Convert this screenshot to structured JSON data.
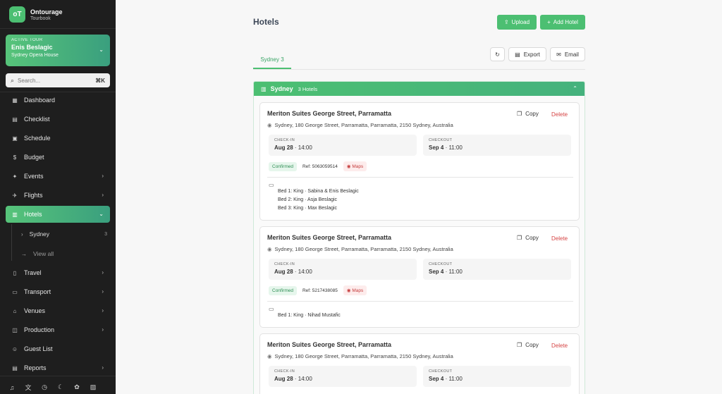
{
  "brand": {
    "logo": "oT",
    "name": "Ontourage",
    "sub": "Tourbook"
  },
  "tour": {
    "label": "ACTIVE TOUR",
    "name": "Enis Beslagic",
    "venue": "Sydney Opera House"
  },
  "search": {
    "placeholder": "Search...",
    "shortcut": "⌘K"
  },
  "nav": [
    {
      "label": "Dashboard"
    },
    {
      "label": "Checklist"
    },
    {
      "label": "Schedule"
    },
    {
      "label": "Budget"
    },
    {
      "label": "Events"
    },
    {
      "label": "Flights"
    },
    {
      "label": "Hotels"
    },
    {
      "label": "Travel"
    },
    {
      "label": "Transport"
    },
    {
      "label": "Venues"
    },
    {
      "label": "Production"
    },
    {
      "label": "Guest List"
    },
    {
      "label": "Reports"
    }
  ],
  "hotels_sub": [
    {
      "label": "Sydney",
      "count": "3"
    },
    {
      "label": "View all"
    }
  ],
  "page": {
    "title": "Hotels",
    "upload": "Upload",
    "add_hotel": "Add Hotel",
    "tab": "Sydney 3",
    "export": "Export",
    "email": "Email"
  },
  "group": {
    "name": "Sydney",
    "count": "3 Hotels"
  },
  "cards": [
    {
      "name": "Meriton Suites George Street, Parramatta",
      "address": "Sydney, 180 George Street, Parramatta, Parramatta, 2150 Sydney, Australia",
      "copy": "Copy",
      "delete": "Delete",
      "checkin_label": "CHECK-IN",
      "checkin_date": "Aug 28",
      "checkin_time": " · 14:00",
      "checkout_label": "CHECKOUT",
      "checkout_date": "Sep 4",
      "checkout_time": " · 11:00",
      "status": "Confirmed",
      "ref": "Ref: 5063059514",
      "maps": "Maps",
      "beds": [
        "Bed 1: King · Sabina & Enis Beslagic",
        "Bed 2: King · Asja Beslagic",
        "Bed 3: King · Max Beslagic"
      ]
    },
    {
      "name": "Meriton Suites George Street, Parramatta",
      "address": "Sydney, 180 George Street, Parramatta, Parramatta, 2150 Sydney, Australia",
      "copy": "Copy",
      "delete": "Delete",
      "checkin_label": "CHECK-IN",
      "checkin_date": "Aug 28",
      "checkin_time": " · 14:00",
      "checkout_label": "CHECKOUT",
      "checkout_date": "Sep 4",
      "checkout_time": " · 11:00",
      "status": "Confirmed",
      "ref": "Ref: 5217438085",
      "maps": "Maps",
      "beds": [
        "Bed 1: King · Nihad Mustafic"
      ]
    },
    {
      "name": "Meriton Suites George Street, Parramatta",
      "address": "Sydney, 180 George Street, Parramatta, Parramatta, 2150 Sydney, Australia",
      "copy": "Copy",
      "delete": "Delete",
      "checkin_label": "CHECK-IN",
      "checkin_date": "Aug 28",
      "checkin_time": " · 14:00",
      "checkout_label": "CHECKOUT",
      "checkout_date": "Sep 4",
      "checkout_time": " · 11:00"
    }
  ],
  "colors": {
    "accent": "#4cbf72",
    "sidebar": "#1e1e1e",
    "danger": "#d64545"
  }
}
